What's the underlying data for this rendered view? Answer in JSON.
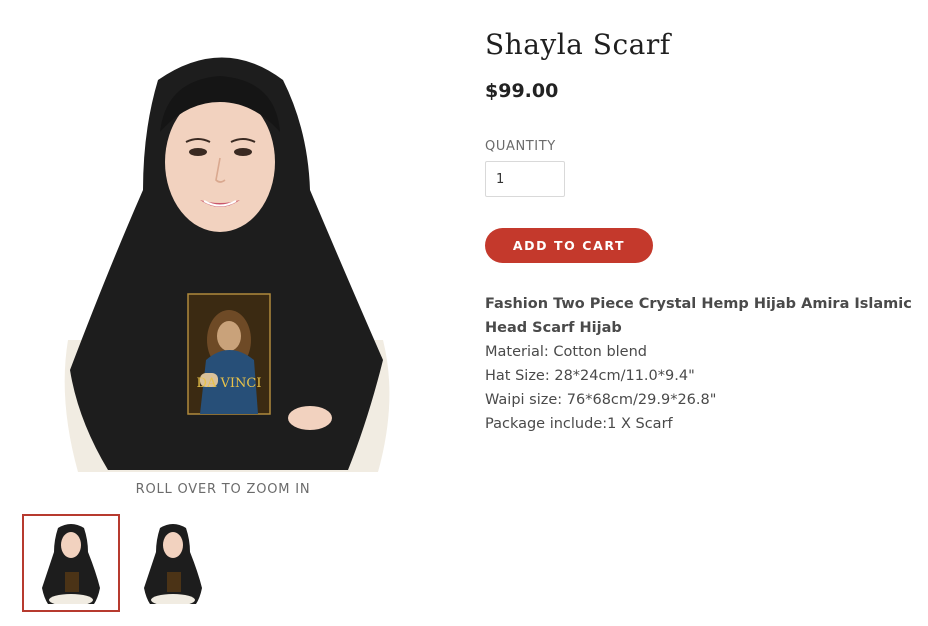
{
  "product": {
    "title": "Shayla Scarf",
    "price": "$99.00",
    "quantity_label": "QUANTITY",
    "quantity_value": "1",
    "add_to_cart_label": "ADD TO CART",
    "zoom_hint": "ROLL OVER TO ZOOM IN",
    "image_print_text": "DA VINCI",
    "description": {
      "title": "Fashion Two Piece Crystal Hemp Hijab Amira Islamic Head Scarf Hijab",
      "lines": [
        "Material: Cotton blend",
        "Hat Size: 28*24cm/11.0*9.4\"",
        "Waipi size: 76*68cm/29.9*26.8\"",
        "Package include:1 X Scarf"
      ]
    }
  },
  "colors": {
    "accent": "#c4392c",
    "thumb_active_border": "#b73a2f",
    "text": "#3d3d3d"
  }
}
